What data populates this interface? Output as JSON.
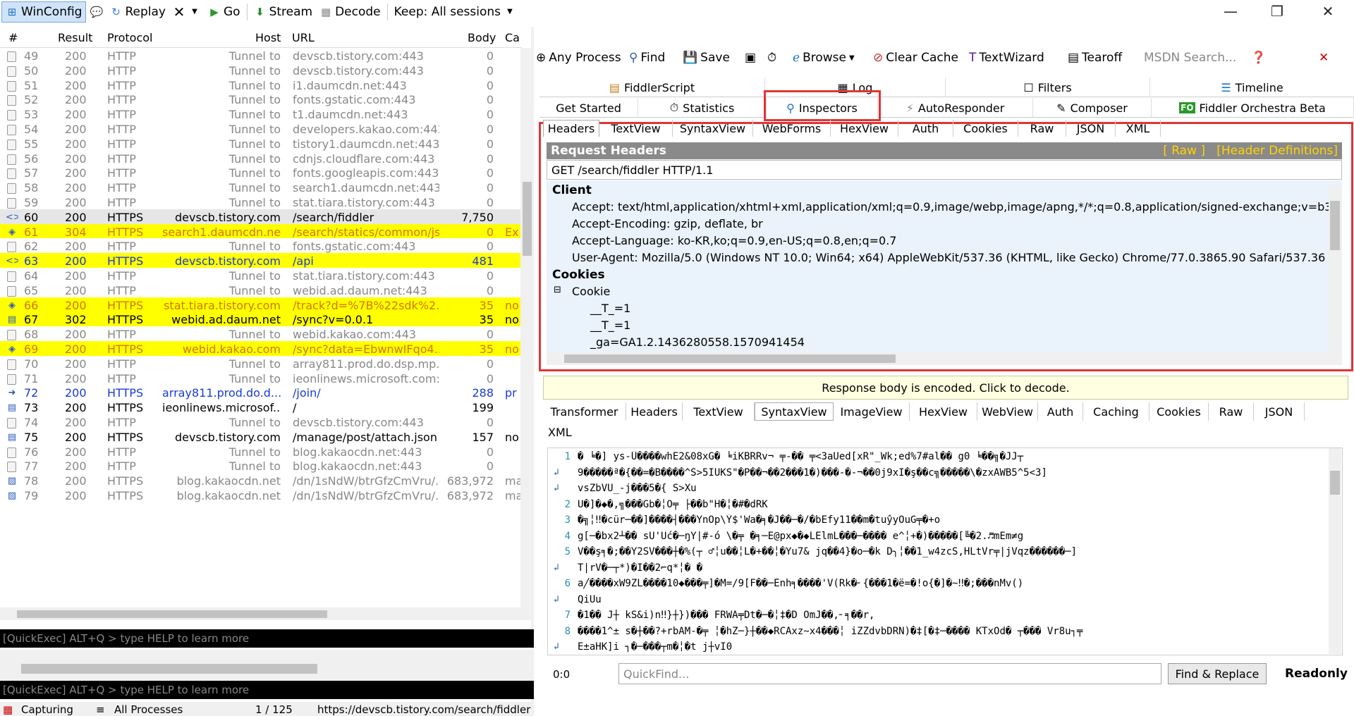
{
  "toolbar": {
    "winconfig": "WinConfig",
    "replay": "Replay",
    "go": "Go",
    "stream": "Stream",
    "decode": "Decode",
    "keep": "Keep: All sessions"
  },
  "sessions": {
    "headers": {
      "num": "#",
      "result": "Result",
      "protocol": "Protocol",
      "host": "Host",
      "url": "URL",
      "body": "Body",
      "caching": "Ca"
    },
    "rows": [
      {
        "num": "49",
        "result": "200",
        "protocol": "HTTP",
        "host": "Tunnel to",
        "url": "devscb.tistory.com:443",
        "body": "0",
        "ca": "",
        "style": "tunnel"
      },
      {
        "num": "50",
        "result": "200",
        "protocol": "HTTP",
        "host": "Tunnel to",
        "url": "devscb.tistory.com:443",
        "body": "0",
        "ca": "",
        "style": "tunnel"
      },
      {
        "num": "51",
        "result": "200",
        "protocol": "HTTP",
        "host": "Tunnel to",
        "url": "i1.daumcdn.net:443",
        "body": "0",
        "ca": "",
        "style": "tunnel"
      },
      {
        "num": "52",
        "result": "200",
        "protocol": "HTTP",
        "host": "Tunnel to",
        "url": "fonts.gstatic.com:443",
        "body": "0",
        "ca": "",
        "style": "tunnel"
      },
      {
        "num": "53",
        "result": "200",
        "protocol": "HTTP",
        "host": "Tunnel to",
        "url": "t1.daumcdn.net:443",
        "body": "0",
        "ca": "",
        "style": "tunnel"
      },
      {
        "num": "54",
        "result": "200",
        "protocol": "HTTP",
        "host": "Tunnel to",
        "url": "developers.kakao.com:443",
        "body": "0",
        "ca": "",
        "style": "tunnel"
      },
      {
        "num": "55",
        "result": "200",
        "protocol": "HTTP",
        "host": "Tunnel to",
        "url": "tistory1.daumcdn.net:443",
        "body": "0",
        "ca": "",
        "style": "tunnel"
      },
      {
        "num": "56",
        "result": "200",
        "protocol": "HTTP",
        "host": "Tunnel to",
        "url": "cdnjs.cloudflare.com:443",
        "body": "0",
        "ca": "",
        "style": "tunnel"
      },
      {
        "num": "57",
        "result": "200",
        "protocol": "HTTP",
        "host": "Tunnel to",
        "url": "fonts.googleapis.com:443",
        "body": "0",
        "ca": "",
        "style": "tunnel"
      },
      {
        "num": "58",
        "result": "200",
        "protocol": "HTTP",
        "host": "Tunnel to",
        "url": "search1.daumcdn.net:443",
        "body": "0",
        "ca": "",
        "style": "tunnel"
      },
      {
        "num": "59",
        "result": "200",
        "protocol": "HTTP",
        "host": "Tunnel to",
        "url": "stat.tiara.tistory.com:443",
        "body": "0",
        "ca": "",
        "style": "tunnel"
      },
      {
        "num": "60",
        "result": "200",
        "protocol": "HTTPS",
        "host": "devscb.tistory.com",
        "url": "/search/fiddler",
        "body": "7,750",
        "ca": "",
        "style": "selected"
      },
      {
        "num": "61",
        "result": "304",
        "protocol": "HTTPS",
        "host": "search1.daumcdn.net",
        "url": "/search/statics/common/js...",
        "body": "0",
        "ca": "Ex",
        "style": "yellow-orange"
      },
      {
        "num": "62",
        "result": "200",
        "protocol": "HTTP",
        "host": "Tunnel to",
        "url": "fonts.gstatic.com:443",
        "body": "0",
        "ca": "",
        "style": "tunnel"
      },
      {
        "num": "63",
        "result": "200",
        "protocol": "HTTPS",
        "host": "devscb.tistory.com",
        "url": "/api",
        "body": "481",
        "ca": "",
        "style": "yellow-blue"
      },
      {
        "num": "64",
        "result": "200",
        "protocol": "HTTP",
        "host": "Tunnel to",
        "url": "stat.tiara.tistory.com:443",
        "body": "0",
        "ca": "",
        "style": "tunnel"
      },
      {
        "num": "65",
        "result": "200",
        "protocol": "HTTP",
        "host": "Tunnel to",
        "url": "webid.ad.daum.net:443",
        "body": "0",
        "ca": "",
        "style": "tunnel"
      },
      {
        "num": "66",
        "result": "200",
        "protocol": "HTTPS",
        "host": "stat.tiara.tistory.com",
        "url": "/track?d=%7B%22sdk%2...",
        "body": "35",
        "ca": "no",
        "style": "yellow-orange"
      },
      {
        "num": "67",
        "result": "302",
        "protocol": "HTTPS",
        "host": "webid.ad.daum.net",
        "url": "/sync?v=0.0.1",
        "body": "35",
        "ca": "no",
        "style": "yellow-black"
      },
      {
        "num": "68",
        "result": "200",
        "protocol": "HTTP",
        "host": "Tunnel to",
        "url": "webid.kakao.com:443",
        "body": "0",
        "ca": "",
        "style": "tunnel"
      },
      {
        "num": "69",
        "result": "200",
        "protocol": "HTTPS",
        "host": "webid.kakao.com",
        "url": "/sync?data=EbwnwIFqo4...",
        "body": "35",
        "ca": "no",
        "style": "yellow-orange"
      },
      {
        "num": "70",
        "result": "200",
        "protocol": "HTTP",
        "host": "Tunnel to",
        "url": "array811.prod.do.dsp.mp...",
        "body": "0",
        "ca": "",
        "style": "tunnel"
      },
      {
        "num": "71",
        "result": "200",
        "protocol": "HTTP",
        "host": "Tunnel to",
        "url": "ieonlinews.microsoft.com:...",
        "body": "0",
        "ca": "",
        "style": "tunnel"
      },
      {
        "num": "72",
        "result": "200",
        "protocol": "HTTPS",
        "host": "array811.prod.do.d...",
        "url": "/join/",
        "body": "288",
        "ca": "pr",
        "style": "blue"
      },
      {
        "num": "73",
        "result": "200",
        "protocol": "HTTPS",
        "host": "ieonlinews.microsof...",
        "url": "/",
        "body": "199",
        "ca": "",
        "style": "dark"
      },
      {
        "num": "74",
        "result": "200",
        "protocol": "HTTP",
        "host": "Tunnel to",
        "url": "devscb.tistory.com:443",
        "body": "0",
        "ca": "",
        "style": "tunnel"
      },
      {
        "num": "75",
        "result": "200",
        "protocol": "HTTPS",
        "host": "devscb.tistory.com",
        "url": "/manage/post/attach.json",
        "body": "157",
        "ca": "no",
        "style": "dark"
      },
      {
        "num": "76",
        "result": "200",
        "protocol": "HTTP",
        "host": "Tunnel to",
        "url": "blog.kakaocdn.net:443",
        "body": "0",
        "ca": "",
        "style": "tunnel"
      },
      {
        "num": "77",
        "result": "200",
        "protocol": "HTTP",
        "host": "Tunnel to",
        "url": "blog.kakaocdn.net:443",
        "body": "0",
        "ca": "",
        "style": "tunnel"
      },
      {
        "num": "78",
        "result": "200",
        "protocol": "HTTPS",
        "host": "blog.kakaocdn.net",
        "url": "/dn/1sNdW/btrGfzCmVru/...",
        "body": "683,972",
        "ca": "ma",
        "style": "gray"
      },
      {
        "num": "79",
        "result": "200",
        "protocol": "HTTPS",
        "host": "blog.kakaocdn.net",
        "url": "/dn/1sNdW/btrGfzCmVru/...",
        "body": "683,972",
        "ca": "ma",
        "style": "gray"
      }
    ]
  },
  "quickexec": "[QuickExec] ALT+Q > type HELP to learn more",
  "status": {
    "capturing": "Capturing",
    "processes": "All Processes",
    "count": "1 / 125",
    "url": "https://devscb.tistory.com/search/fiddler"
  },
  "rtoolbar": {
    "any_process": "Any Process",
    "find": "Find",
    "save": "Save",
    "browse": "Browse",
    "clear_cache": "Clear Cache",
    "textwizard": "TextWizard",
    "tearoff": "Tearoff",
    "msdn": "MSDN Search..."
  },
  "tabs1": {
    "fiddlerscript": "FiddlerScript",
    "log": "Log",
    "filters": "Filters",
    "timeline": "Timeline"
  },
  "tabs2": {
    "get_started": "Get Started",
    "statistics": "Statistics",
    "inspectors": "Inspectors",
    "autoresponder": "AutoResponder",
    "composer": "Composer",
    "orchestra": "Fiddler Orchestra Beta",
    "fo": "FO"
  },
  "req_tabs": [
    "Headers",
    "TextView",
    "SyntaxView",
    "WebForms",
    "HexView",
    "Auth",
    "Cookies",
    "Raw",
    "JSON",
    "XML"
  ],
  "request": {
    "title": "Request Headers",
    "raw": "[ Raw ]",
    "defs": "[Header Definitions]",
    "line": "GET /search/fiddler HTTP/1.1",
    "client": "Client",
    "accept": "Accept: text/html,application/xhtml+xml,application/xml;q=0.9,image/webp,image/apng,*/*;q=0.8,application/signed-exchange;v=b3",
    "encoding": "Accept-Encoding: gzip, deflate, br",
    "language": "Accept-Language: ko-KR,ko;q=0.9,en-US;q=0.8,en;q=0.7",
    "agent": "User-Agent: Mozilla/5.0 (Windows NT 10.0; Win64; x64) AppleWebKit/537.36 (KHTML, like Gecko) Chrome/77.0.3865.90 Safari/537.36",
    "cookies": "Cookies",
    "cookie": "Cookie",
    "c1": "__T_=1",
    "c2": "__T_=1",
    "c3": "_ga=GA1.2.1436280558.1570941454"
  },
  "encoded_msg": "Response body is encoded. Click to decode.",
  "resp_tabs": [
    "Transformer",
    "Headers",
    "TextView",
    "SyntaxView",
    "ImageView",
    "HexView",
    "WebView",
    "Auth",
    "Caching",
    "Cookies",
    "Raw",
    "JSON"
  ],
  "resp_xml": "XML",
  "code_lines": [
    {
      "ln": "1",
      "wrap": false,
      "text": "�\u0002 ╘�] ys-Û����wh\u0001\u0001E2&08x\u0001G� ╘iK\u0001BRRv¬ ╤-�� ╤<3\u0001a\u0001U\u0001ed[\u0001x\u0001R\"_W\u0001\u0001k;\u0001ed%\u00017\u0001\u0001\u0001#\u0001\u0001al�� g0 ╘��╗�J\u0001J┬"
    },
    {
      "ln": "",
      "wrap": true,
      "text": "9�����ª�{��=�B����^Ś>5I\u0001\u0001\u0001UKS\"�P��¬��2���1�)���-�-¬��0j9\u0001xI�ş��c╗�����\\�z\u0001xA\u0001W\u0001B5^5<\u00013]"
    },
    {
      "ln": "",
      "wrap": true,
      "text": "\u0001v\u0001sZ\u0001bVU\u0001\u0001\u0001_\u0001\u0001\u0001\u0001-j���5�{ S\u0001\u0001>X\u0001u"
    },
    {
      "ln": "2",
      "wrap": false,
      "text": "\u0001U�]�◆�,╗���G\u0001\u0001b�╎O╤ ├��b\"\u0001H�╎�#�dRK"
    },
    {
      "ln": "3",
      "wrap": false,
      "text": "�╗╎‼�cü\u0001\u0001r─��]����┤���YnOp\\Ÿ\u0001$\u0001'\u0001Wa�╕�J��─�/�b\u0001\u0001Efy11��m�tuŷyOu\u0001G╤�+o\u0001"
    },
    {
      "ln": "4",
      "wrap": false,
      "text": "g[─�b\u0001x2┴�� s\u0001U\u0001'U\u0001\u0001\u0001\u0001\u0001ć�─ŋY|#-ó \\�╤ �╕─E\u0001@p\u0001\u0001\u0001\u0001\u0001x◆�◆L\u0001E\u0001l\u0001mL���─���� e^╎+�)�����[╚�2.♬m\u0001Em\u0001\u0001≠g\u0001"
    },
    {
      "ln": "5",
      "wrap": false,
      "text": "\u0001V��ş╕�;��\u0001Y2\u0001S\u0001V���┼�%(┬ ♂╎u��╎L�+��╎�Yu7&\u0001\u0001 jq��4}�o─�k D╮╎��1_w4zcS,\u0001HLtVr╤\u0001|\u0001\u0001j\u0001\u0001V\u0001q\u0001z������─]"
    },
    {
      "ln": "",
      "wrap": true,
      "text": "\u0001T|\u0001rV�─┬*)�I��2⌐q*╎� �"
    },
    {
      "ln": "6",
      "wrap": false,
      "text": "\u0001a╱����x\u0001W\u00019\u0001Z\u0001L����10◆���╤]�M\u0001=/\u00019\u0001\u0001[F��─Èn\u0001\u0001\u0001h╕����'V(\u0001\u0001Rk�╴{���1�ë=�!o{�]�~‼�;���nMv\u0001()"
    },
    {
      "ln": "",
      "wrap": true,
      "text": "\u0001\u0001Q\u0001i\u0001\u0001U\u0001\u0001\u0001\u0001u"
    },
    {
      "ln": "7",
      "wrap": false,
      "text": "�1\u0001�� J┼ kS\u0001&\u0001i)n‼}┼})��� FRWA╤Dt�─�╎‡�D Om\u0001J��,╴╕��r,"
    },
    {
      "ln": "8",
      "wrap": false,
      "text": "����1^± s�┼��?+r\u0001\u0001bA\u0001\u0001M-�╤ ╎�hZ─}┼��◆RCA\u0001xz~x4���╎ iZ\u0001ZdvbDR\u0001N)�‡[�‡─���� K\u0001\u0001\u0001T\u0001xOd� ┬��� Vr8u┐╤"
    },
    {
      "ln": "",
      "wrap": true,
      "text": "E±\u0001aH\u0001K\u0001]\u0001\u0001i ┐�─���┬m�╎�t j┼vI0"
    }
  ],
  "bottom": {
    "pos": "0:0",
    "quickfind": "QuickFind...",
    "find_replace": "Find & Replace",
    "readonly": "Readonly"
  }
}
